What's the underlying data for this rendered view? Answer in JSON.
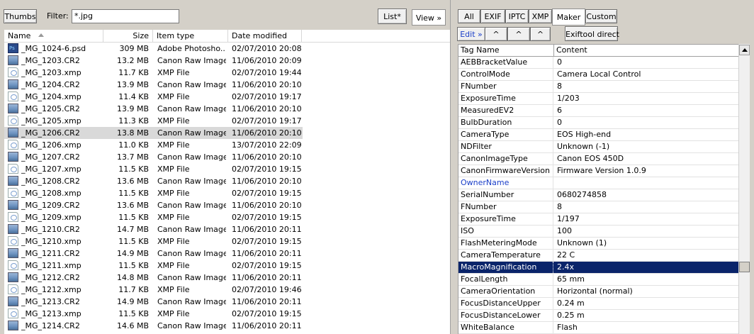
{
  "left_toolbar": {
    "thumbs_label": "Thumbs",
    "filter_label": "Filter:",
    "filter_value": "*.jpg",
    "list_label": "List*",
    "view_label": "View »"
  },
  "file_columns": [
    "Name",
    "Size",
    "Item type",
    "Date modified"
  ],
  "files": [
    {
      "name": "_MG_1024-6.psd",
      "size": "309 MB",
      "type": "Adobe Photosho...",
      "date": "02/07/2010 20:08",
      "icon": "psd-file-icon"
    },
    {
      "name": "_MG_1203.CR2",
      "size": "13.2 MB",
      "type": "Canon Raw Image",
      "date": "11/06/2010 20:09",
      "icon": "raw-image-icon"
    },
    {
      "name": "_MG_1203.xmp",
      "size": "11.7 KB",
      "type": "XMP File",
      "date": "02/07/2010 19:44",
      "icon": "xmp-file-icon"
    },
    {
      "name": "_MG_1204.CR2",
      "size": "13.9 MB",
      "type": "Canon Raw Image",
      "date": "11/06/2010 20:10",
      "icon": "raw-image-icon"
    },
    {
      "name": "_MG_1204.xmp",
      "size": "11.4 KB",
      "type": "XMP File",
      "date": "02/07/2010 19:17",
      "icon": "xmp-file-icon"
    },
    {
      "name": "_MG_1205.CR2",
      "size": "13.9 MB",
      "type": "Canon Raw Image",
      "date": "11/06/2010 20:10",
      "icon": "raw-image-icon"
    },
    {
      "name": "_MG_1205.xmp",
      "size": "11.3 KB",
      "type": "XMP File",
      "date": "02/07/2010 19:17",
      "icon": "xmp-file-icon"
    },
    {
      "name": "_MG_1206.CR2",
      "size": "13.8 MB",
      "type": "Canon Raw Image",
      "date": "11/06/2010 20:10",
      "icon": "raw-image-icon"
    },
    {
      "name": "_MG_1206.xmp",
      "size": "11.0 KB",
      "type": "XMP File",
      "date": "13/07/2010 22:09",
      "icon": "xmp-file-icon"
    },
    {
      "name": "_MG_1207.CR2",
      "size": "13.7 MB",
      "type": "Canon Raw Image",
      "date": "11/06/2010 20:10",
      "icon": "raw-image-icon"
    },
    {
      "name": "_MG_1207.xmp",
      "size": "11.5 KB",
      "type": "XMP File",
      "date": "02/07/2010 19:15",
      "icon": "xmp-file-icon"
    },
    {
      "name": "_MG_1208.CR2",
      "size": "13.6 MB",
      "type": "Canon Raw Image",
      "date": "11/06/2010 20:10",
      "icon": "raw-image-icon"
    },
    {
      "name": "_MG_1208.xmp",
      "size": "11.5 KB",
      "type": "XMP File",
      "date": "02/07/2010 19:15",
      "icon": "xmp-file-icon"
    },
    {
      "name": "_MG_1209.CR2",
      "size": "13.6 MB",
      "type": "Canon Raw Image",
      "date": "11/06/2010 20:10",
      "icon": "raw-image-icon"
    },
    {
      "name": "_MG_1209.xmp",
      "size": "11.5 KB",
      "type": "XMP File",
      "date": "02/07/2010 19:15",
      "icon": "xmp-file-icon"
    },
    {
      "name": "_MG_1210.CR2",
      "size": "14.7 MB",
      "type": "Canon Raw Image",
      "date": "11/06/2010 20:11",
      "icon": "raw-image-icon"
    },
    {
      "name": "_MG_1210.xmp",
      "size": "11.5 KB",
      "type": "XMP File",
      "date": "02/07/2010 19:15",
      "icon": "xmp-file-icon"
    },
    {
      "name": "_MG_1211.CR2",
      "size": "14.9 MB",
      "type": "Canon Raw Image",
      "date": "11/06/2010 20:11",
      "icon": "raw-image-icon"
    },
    {
      "name": "_MG_1211.xmp",
      "size": "11.5 KB",
      "type": "XMP File",
      "date": "02/07/2010 19:15",
      "icon": "xmp-file-icon"
    },
    {
      "name": "_MG_1212.CR2",
      "size": "14.8 MB",
      "type": "Canon Raw Image",
      "date": "11/06/2010 20:11",
      "icon": "raw-image-icon"
    },
    {
      "name": "_MG_1212.xmp",
      "size": "11.7 KB",
      "type": "XMP File",
      "date": "02/07/2010 19:46",
      "icon": "xmp-file-icon"
    },
    {
      "name": "_MG_1213.CR2",
      "size": "14.9 MB",
      "type": "Canon Raw Image",
      "date": "11/06/2010 20:11",
      "icon": "raw-image-icon"
    },
    {
      "name": "_MG_1213.xmp",
      "size": "11.5 KB",
      "type": "XMP File",
      "date": "02/07/2010 19:15",
      "icon": "xmp-file-icon"
    },
    {
      "name": "_MG_1214.CR2",
      "size": "14.6 MB",
      "type": "Canon Raw Image",
      "date": "11/06/2010 20:11",
      "icon": "raw-image-icon"
    }
  ],
  "selected_file": "_MG_1206.CR2",
  "right_toolbar": {
    "tabs": [
      "All",
      "EXIF",
      "IPTC",
      "XMP",
      "Maker",
      "Custom"
    ],
    "active_tab": "Maker",
    "edit_label": "Edit »",
    "caret_buttons": [
      "^",
      "^",
      "^"
    ],
    "exiftool_label": "Exiftool direct"
  },
  "tag_columns": [
    "Tag Name",
    "Content"
  ],
  "tags": [
    {
      "name": "AEBBracketValue",
      "value": "0"
    },
    {
      "name": "ControlMode",
      "value": "Camera Local Control"
    },
    {
      "name": "FNumber",
      "value": "8"
    },
    {
      "name": "ExposureTime",
      "value": "1/203"
    },
    {
      "name": "MeasuredEV2",
      "value": "6"
    },
    {
      "name": "BulbDuration",
      "value": "0"
    },
    {
      "name": "CameraType",
      "value": "EOS High-end"
    },
    {
      "name": "NDFilter",
      "value": "Unknown (-1)"
    },
    {
      "name": "CanonImageType",
      "value": "Canon EOS 450D"
    },
    {
      "name": "CanonFirmwareVersion",
      "value": "Firmware Version 1.0.9"
    },
    {
      "name": "OwnerName",
      "value": ""
    },
    {
      "name": "SerialNumber",
      "value": "0680274858"
    },
    {
      "name": "FNumber",
      "value": "8"
    },
    {
      "name": "ExposureTime",
      "value": "1/197"
    },
    {
      "name": "ISO",
      "value": "100"
    },
    {
      "name": "FlashMeteringMode",
      "value": "Unknown (1)"
    },
    {
      "name": "CameraTemperature",
      "value": "22 C"
    },
    {
      "name": "MacroMagnification",
      "value": "2.4x"
    },
    {
      "name": "FocalLength",
      "value": "65 mm"
    },
    {
      "name": "CameraOrientation",
      "value": "Horizontal (normal)"
    },
    {
      "name": "FocusDistanceUpper",
      "value": "0.24 m"
    },
    {
      "name": "FocusDistanceLower",
      "value": "0.25 m"
    },
    {
      "name": "WhiteBalance",
      "value": "Flash"
    }
  ],
  "highlighted_tag": "MacroMagnification",
  "colors": {
    "selection": "#0a246a",
    "owner_link": "#1a3ec8",
    "row_selected": "#d9d9d9"
  }
}
